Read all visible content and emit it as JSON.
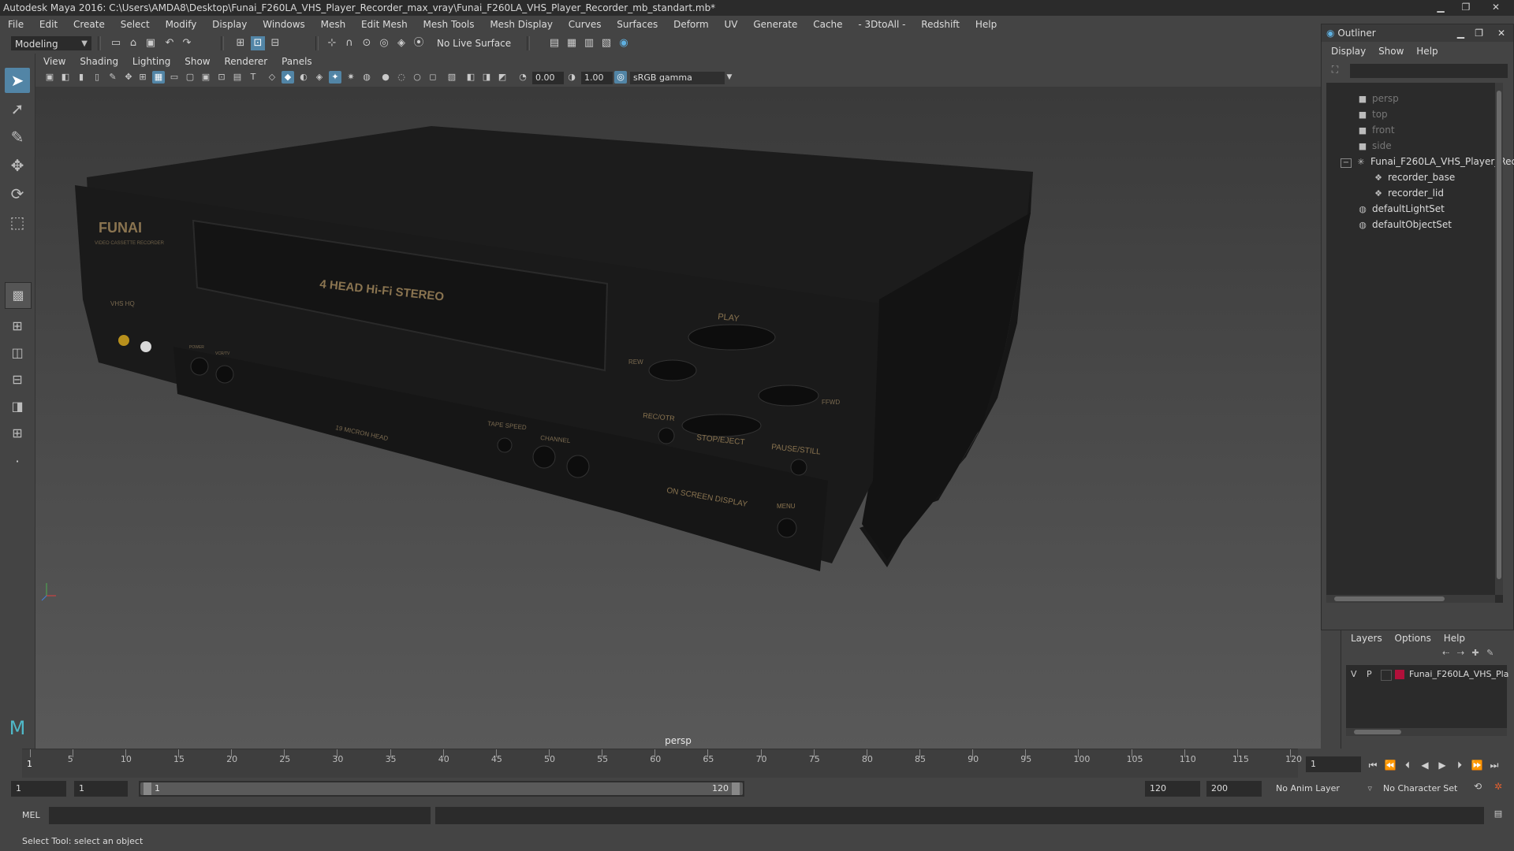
{
  "window": {
    "title": "Autodesk Maya 2016: C:\\Users\\AMDA8\\Desktop\\Funai_F260LA_VHS_Player_Recorder_max_vray\\Funai_F260LA_VHS_Player_Recorder_mb_standart.mb*",
    "minimize": "▁",
    "maximize": "❐",
    "close": "✕"
  },
  "menubar": [
    "File",
    "Edit",
    "Create",
    "Select",
    "Modify",
    "Display",
    "Windows",
    "Mesh",
    "Edit Mesh",
    "Mesh Tools",
    "Mesh Display",
    "Curves",
    "Surfaces",
    "Deform",
    "UV",
    "Generate",
    "Cache",
    "- 3DtoAll -",
    "Redshift",
    "Help"
  ],
  "statusline": {
    "mode": "Modeling",
    "live_surface": "No Live Surface"
  },
  "panel": {
    "menu": [
      "View",
      "Shading",
      "Lighting",
      "Show",
      "Renderer",
      "Panels"
    ],
    "exposure": "0.00",
    "gamma": "1.00",
    "color_space": "sRGB gamma",
    "camera_label": "persp"
  },
  "model_text": {
    "brand": "FUNAI",
    "subtitle": "VIDEO CASSETTE RECORDER",
    "head": "4 HEAD Hi-Fi STEREO",
    "vhs": "VHS HQ",
    "play": "PLAY",
    "rew": "REW",
    "ffwd": "FFWD",
    "rec": "REC/OTR",
    "stop": "STOP/EJECT",
    "pause": "PAUSE/STILL",
    "tape_speed": "TAPE SPEED",
    "channel": "CHANNEL",
    "micron": "19 MICRON HEAD",
    "osd": "ON SCREEN DISPLAY",
    "menu": "MENU",
    "power": "POWER",
    "vcrtv": "VCR/TV"
  },
  "outliner": {
    "title": "Outliner",
    "menu": [
      "Display",
      "Show",
      "Help"
    ],
    "items": [
      {
        "label": "persp",
        "dim": true,
        "icon": "camera-icon"
      },
      {
        "label": "top",
        "dim": true,
        "icon": "camera-icon"
      },
      {
        "label": "front",
        "dim": true,
        "icon": "camera-icon"
      },
      {
        "label": "side",
        "dim": true,
        "icon": "camera-icon"
      },
      {
        "label": "Funai_F260LA_VHS_Player_Rec",
        "dim": false,
        "icon": "group-icon"
      },
      {
        "label": "recorder_base",
        "dim": false,
        "icon": "mesh-icon"
      },
      {
        "label": "recorder_lid",
        "dim": false,
        "icon": "mesh-icon"
      },
      {
        "label": "defaultLightSet",
        "dim": false,
        "icon": "set-icon"
      },
      {
        "label": "defaultObjectSet",
        "dim": false,
        "icon": "set-icon"
      }
    ]
  },
  "layers": {
    "menu": [
      "Layers",
      "Options",
      "Help"
    ],
    "row": {
      "v": "V",
      "p": "P",
      "name": "Funai_F260LA_VHS_Pla",
      "color": "#b0103a"
    }
  },
  "timeline": {
    "ticks": [
      1,
      5,
      10,
      15,
      20,
      25,
      30,
      35,
      40,
      45,
      50,
      55,
      60,
      65,
      70,
      75,
      80,
      85,
      90,
      95,
      100,
      105,
      110,
      115,
      120
    ],
    "labels": [
      "5",
      "10",
      "15",
      "20",
      "25",
      "30",
      "35",
      "40",
      "45",
      "50",
      "55",
      "60",
      "65",
      "70",
      "75",
      "80",
      "85",
      "90",
      "95",
      "100",
      "105",
      "110",
      "115",
      "120"
    ],
    "current_frame": "1",
    "current_marker": "1"
  },
  "range": {
    "start": "1",
    "playback_start": "1",
    "slider_start": "1",
    "slider_end": "120",
    "playback_end": "120",
    "end": "200",
    "anim_layer": "No Anim Layer",
    "char_set": "No Character Set"
  },
  "cmd": {
    "label": "MEL"
  },
  "help": {
    "text": "Select Tool: select an object"
  },
  "colors": {
    "accent": "#5285a6",
    "layer": "#b0103a"
  }
}
